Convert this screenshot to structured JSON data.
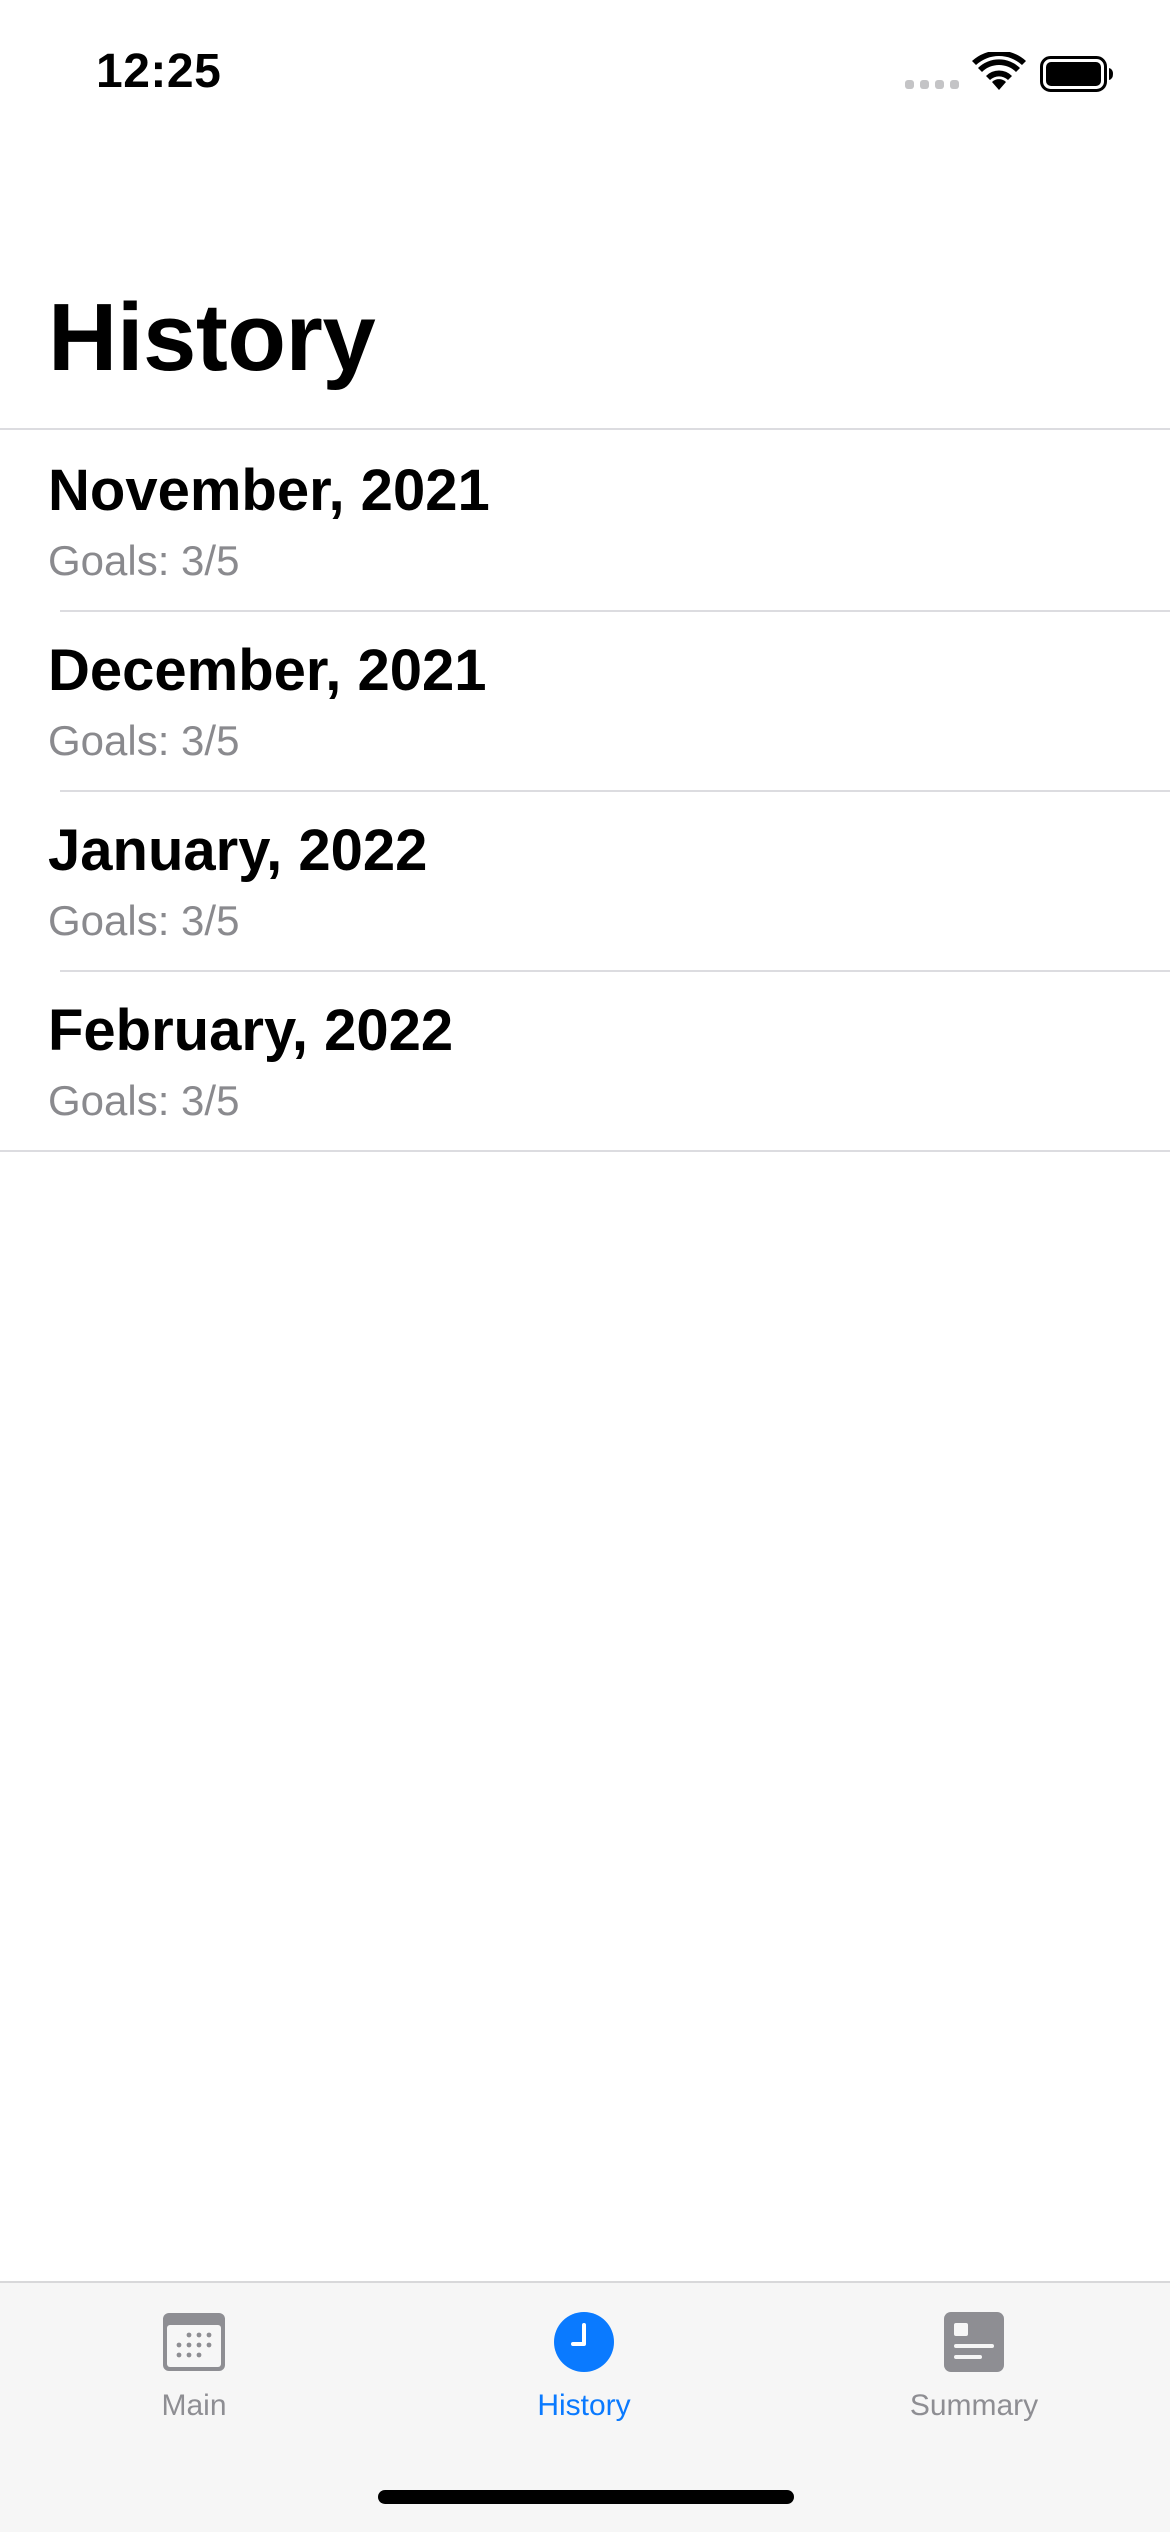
{
  "status_bar": {
    "time": "12:25"
  },
  "page": {
    "title": "History"
  },
  "history": {
    "items": [
      {
        "title": "November, 2021",
        "subtitle": "Goals: 3/5"
      },
      {
        "title": "December, 2021",
        "subtitle": "Goals: 3/5"
      },
      {
        "title": "January, 2022",
        "subtitle": "Goals: 3/5"
      },
      {
        "title": "February, 2022",
        "subtitle": "Goals: 3/5"
      }
    ]
  },
  "tab_bar": {
    "tabs": [
      {
        "label": "Main",
        "icon": "calendar-icon",
        "selected": false
      },
      {
        "label": "History",
        "icon": "clock-icon",
        "selected": true
      },
      {
        "label": "Summary",
        "icon": "summary-card-icon",
        "selected": false
      }
    ]
  },
  "colors": {
    "accent": "#0a7aff",
    "secondary_text": "#8a8a8e",
    "inactive_tab": "#8e8e93",
    "separator": "#dcdce0",
    "tab_bar_background": "#f6f6f6"
  }
}
